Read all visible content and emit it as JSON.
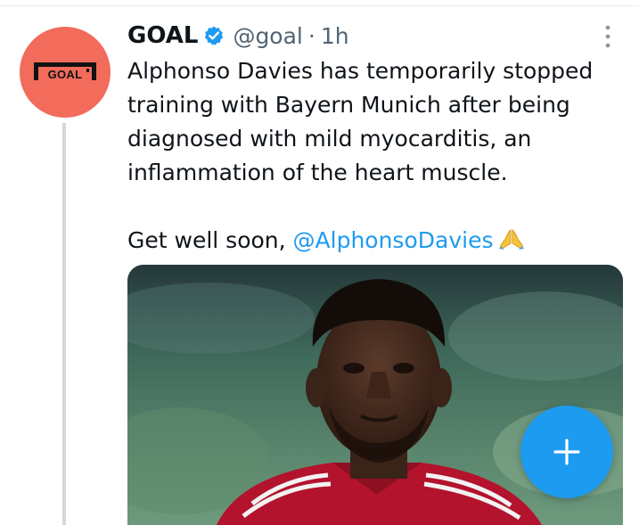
{
  "tweet": {
    "display_name": "GOAL",
    "handle": "@goal",
    "separator": "·",
    "timestamp": "1h",
    "lines": [
      "Alphonso Davies has temporarily stopped",
      "training with Bayern Munich after being",
      "diagnosed with mild myocarditis, an",
      "inflammation of the heart muscle."
    ],
    "closing_text": "Get well soon, ",
    "mention": "@AlphonsoDavies",
    "mention_color": "#1d9bf0"
  },
  "avatar": {
    "logo_text": "GOAL",
    "background": "#f26b5b"
  },
  "icons": {
    "verified": "verified-badge-icon",
    "more": "more-vertical-icon",
    "emoji": "folded-hands-icon",
    "compose": "plus-icon"
  },
  "colors": {
    "accent": "#1d9bf0",
    "text": "#0f1419",
    "secondary_text": "#536471",
    "thread_line": "#cfd9de"
  }
}
